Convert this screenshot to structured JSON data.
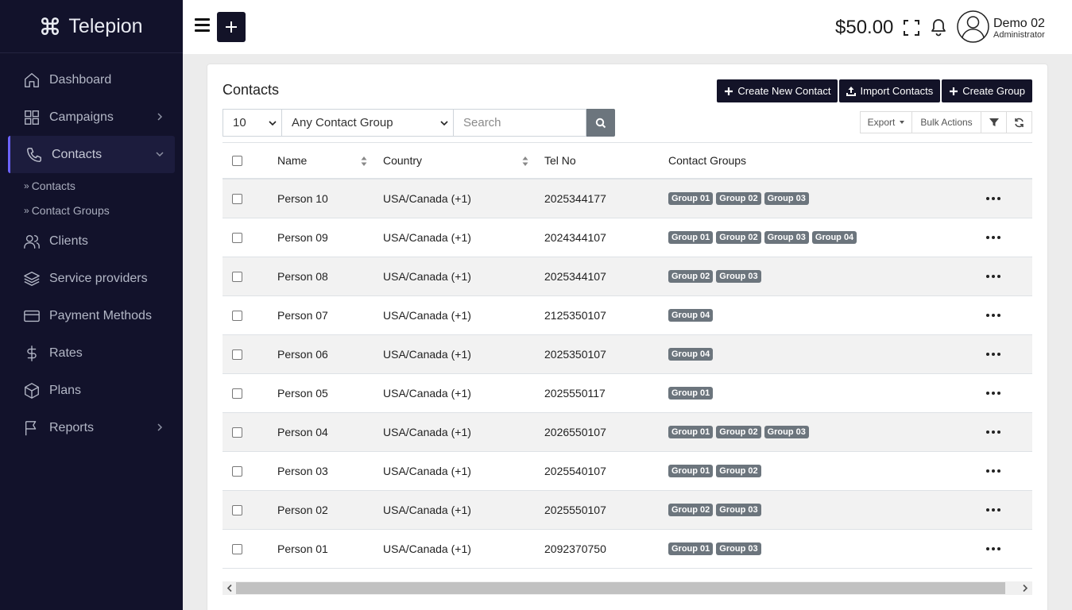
{
  "app": {
    "name": "Telepion"
  },
  "sidebar": {
    "items": [
      {
        "label": "Dashboard",
        "icon": "home-icon"
      },
      {
        "label": "Campaigns",
        "icon": "grid-icon",
        "has_children": true
      },
      {
        "label": "Contacts",
        "icon": "phone-icon",
        "active": true,
        "expanded": true,
        "children": [
          {
            "label": "Contacts"
          },
          {
            "label": "Contact Groups"
          }
        ]
      },
      {
        "label": "Clients",
        "icon": "users-icon"
      },
      {
        "label": "Service providers",
        "icon": "layers-icon"
      },
      {
        "label": "Payment Methods",
        "icon": "credit-card-icon"
      },
      {
        "label": "Rates",
        "icon": "dollar-icon"
      },
      {
        "label": "Plans",
        "icon": "package-icon"
      },
      {
        "label": "Reports",
        "icon": "flag-icon",
        "has_children": true
      }
    ]
  },
  "topbar": {
    "balance": "$50.00",
    "user": {
      "name": "Demo 02",
      "role": "Administrator"
    }
  },
  "contacts": {
    "title": "Contacts",
    "actions": {
      "create_contact": "Create New Contact",
      "import_contacts": "Import Contacts",
      "create_group": "Create Group"
    },
    "filters": {
      "page_size": "10",
      "group": "Any Contact Group",
      "search_placeholder": "Search"
    },
    "tools": {
      "export": "Export",
      "bulk_actions": "Bulk Actions"
    },
    "columns": [
      "Name",
      "Country",
      "Tel No",
      "Contact Groups"
    ],
    "rows": [
      {
        "name": "Person 10",
        "country": "USA/Canada (+1)",
        "tel": "2025344177",
        "groups": [
          "Group 01",
          "Group 02",
          "Group 03"
        ]
      },
      {
        "name": "Person 09",
        "country": "USA/Canada (+1)",
        "tel": "2024344107",
        "groups": [
          "Group 01",
          "Group 02",
          "Group 03",
          "Group 04"
        ]
      },
      {
        "name": "Person 08",
        "country": "USA/Canada (+1)",
        "tel": "2025344107",
        "groups": [
          "Group 02",
          "Group 03"
        ]
      },
      {
        "name": "Person 07",
        "country": "USA/Canada (+1)",
        "tel": "2125350107",
        "groups": [
          "Group 04"
        ]
      },
      {
        "name": "Person 06",
        "country": "USA/Canada (+1)",
        "tel": "2025350107",
        "groups": [
          "Group 04"
        ]
      },
      {
        "name": "Person 05",
        "country": "USA/Canada (+1)",
        "tel": "2025550117",
        "groups": [
          "Group 01"
        ]
      },
      {
        "name": "Person 04",
        "country": "USA/Canada (+1)",
        "tel": "2026550107",
        "groups": [
          "Group 01",
          "Group 02",
          "Group 03"
        ]
      },
      {
        "name": "Person 03",
        "country": "USA/Canada (+1)",
        "tel": "2025540107",
        "groups": [
          "Group 01",
          "Group 02"
        ]
      },
      {
        "name": "Person 02",
        "country": "USA/Canada (+1)",
        "tel": "2025550107",
        "groups": [
          "Group 02",
          "Group 03"
        ]
      },
      {
        "name": "Person 01",
        "country": "USA/Canada (+1)",
        "tel": "2092370750",
        "groups": [
          "Group 01",
          "Group 03"
        ]
      }
    ]
  },
  "colors": {
    "sidebar_bg": "#12122b",
    "accent": "#6c63ff",
    "badge": "#6c757d",
    "dark_button": "#131328"
  }
}
